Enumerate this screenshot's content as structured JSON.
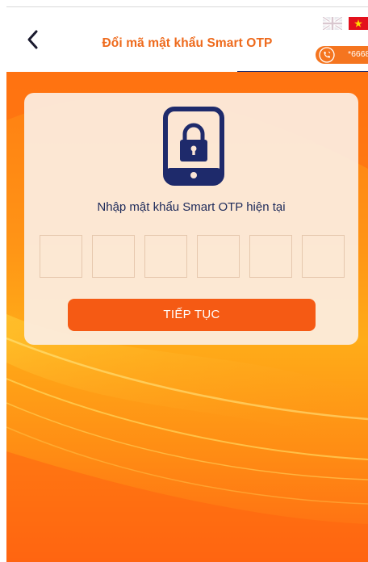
{
  "header": {
    "title": "Đổi mã mật khẩu Smart OTP",
    "hotline": "*6668",
    "languages": [
      "en",
      "vi"
    ]
  },
  "card": {
    "prompt": "Nhập mật khẩu Smart OTP hiện tại",
    "otp_box_count": 6,
    "otp_values": [
      "",
      "",
      "",
      "",
      "",
      ""
    ],
    "continue_label": "TIẾP TỤC"
  },
  "icons": {
    "back": "chevron-left-icon",
    "lock_phone": "phone-lock-icon",
    "hotline": "phone-icon",
    "flag_en": "uk-flag-icon",
    "flag_vi": "vietnam-flag-icon"
  },
  "colors": {
    "accent": "#ee6a1c",
    "button": "#f55a14",
    "navy": "#1d2a5a",
    "hotline_bg": "#f5751f"
  }
}
